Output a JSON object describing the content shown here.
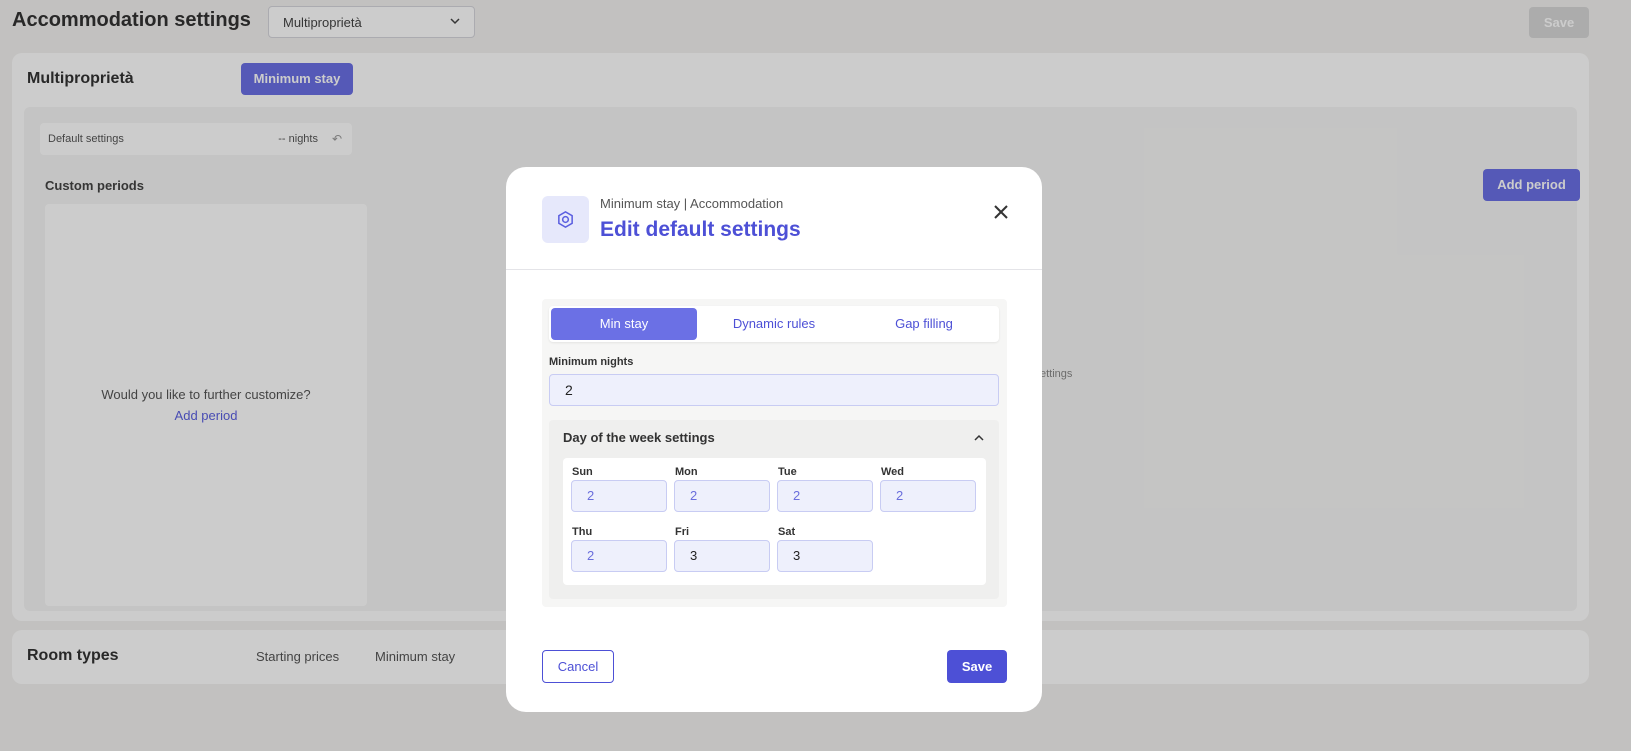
{
  "page": {
    "title": "Accommodation settings",
    "property_select": "Multiproprietà",
    "save_label": "Save"
  },
  "property_card": {
    "name": "Multiproprietà",
    "active_tab": "Minimum stay",
    "default_settings_label": "Default settings",
    "default_settings_value": "-- nights",
    "custom_periods_title": "Custom periods",
    "customize_question": "Would you like to further customize?",
    "add_period_link": "Add period",
    "add_period_button": "Add period",
    "partial_hint": "ettings"
  },
  "room_types": {
    "title": "Room types",
    "tabs": [
      "Starting prices",
      "Minimum stay"
    ]
  },
  "modal": {
    "subtitle": "Minimum stay | Accommodation",
    "title": "Edit default settings",
    "tabs": [
      "Min stay",
      "Dynamic rules",
      "Gap filling"
    ],
    "active_tab": "Min stay",
    "minimum_nights_label": "Minimum nights",
    "minimum_nights_value": "2",
    "dow_title": "Day of the week settings",
    "days": [
      {
        "label": "Sun",
        "value": "2",
        "state": "placeholder"
      },
      {
        "label": "Mon",
        "value": "2",
        "state": "placeholder"
      },
      {
        "label": "Tue",
        "value": "2",
        "state": "placeholder"
      },
      {
        "label": "Wed",
        "value": "2",
        "state": "placeholder"
      },
      {
        "label": "Thu",
        "value": "2",
        "state": "placeholder"
      },
      {
        "label": "Fri",
        "value": "3",
        "state": "filled"
      },
      {
        "label": "Sat",
        "value": "3",
        "state": "filled"
      }
    ],
    "cancel_label": "Cancel",
    "save_label": "Save"
  },
  "colors": {
    "accent": "#4d50d6",
    "accent_light": "#6b70e5",
    "input_bg": "#eef0fc"
  },
  "icons": {
    "modal_icon": "settings-gear-icon",
    "close": "close-icon",
    "collapse": "chevron-up-icon",
    "select": "chevron-down-icon",
    "undo": "undo-icon"
  }
}
